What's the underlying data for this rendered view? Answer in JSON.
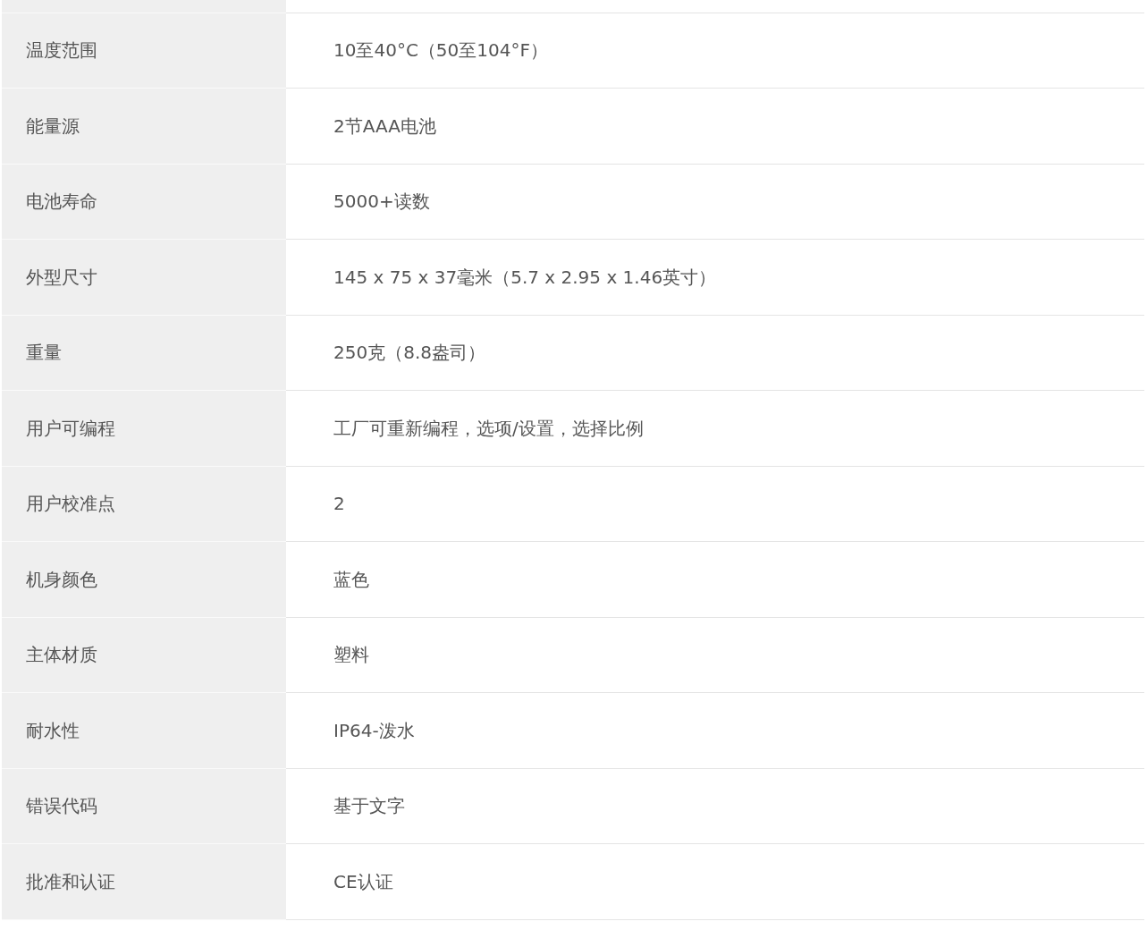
{
  "spec_table": {
    "rows": [
      {
        "label": "温度范围",
        "value": "10至40°C（50至104°F）"
      },
      {
        "label": "能量源",
        "value": "2节AAA电池"
      },
      {
        "label": "电池寿命",
        "value": "5000+读数"
      },
      {
        "label": "外型尺寸",
        "value": "145 x 75 x 37毫米（5.7 x 2.95 x 1.46英寸）"
      },
      {
        "label": "重量",
        "value": "250克（8.8盎司）"
      },
      {
        "label": "用户可编程",
        "value": "工厂可重新编程，选项/设置，选择比例"
      },
      {
        "label": "用户校准点",
        "value": "2"
      },
      {
        "label": "机身颜色",
        "value": "蓝色"
      },
      {
        "label": "主体材质",
        "value": "塑料"
      },
      {
        "label": "耐水性",
        "value": "IP64-泼水"
      },
      {
        "label": "错误代码",
        "value": "基于文字"
      },
      {
        "label": "批准和认证",
        "value": "CE认证"
      }
    ]
  }
}
